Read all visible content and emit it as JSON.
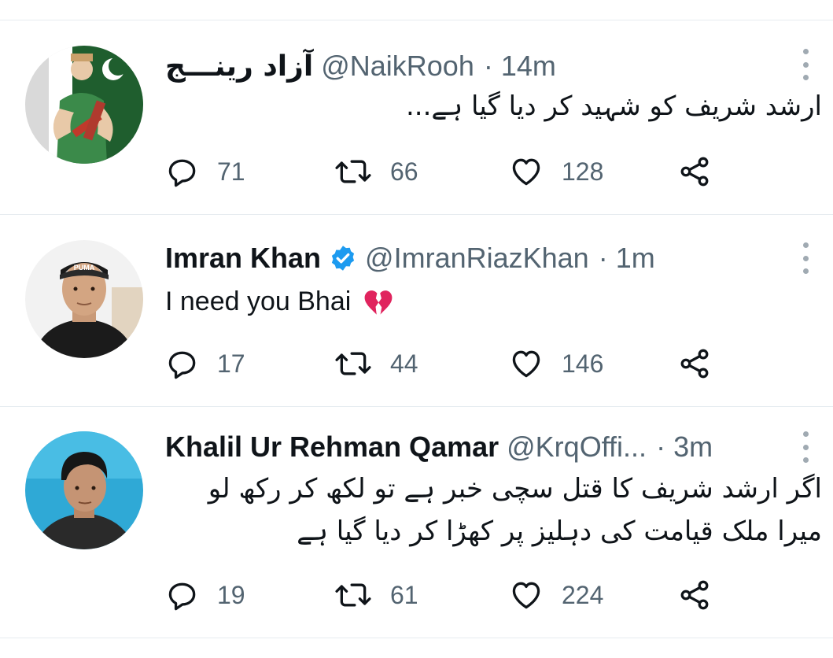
{
  "tweets": [
    {
      "display_name": "آزاد رینـــج",
      "handle": "@NaikRooh",
      "separator": "·",
      "time": "14m",
      "text": "ارشد شریف کو شہید کر دیا گیا ہے...",
      "replies": "71",
      "retweets": "66",
      "likes": "128"
    },
    {
      "display_name": "Imran Khan",
      "handle": "@ImranRiazKhan",
      "separator": "·",
      "time": "1m",
      "text": "I need you Bhai",
      "emoji": "broken-heart",
      "verified": true,
      "replies": "17",
      "retweets": "44",
      "likes": "146"
    },
    {
      "display_name": "Khalil Ur Rehman Qamar",
      "handle": "@KrqOffi...",
      "separator": "·",
      "time": "3m",
      "text_line1": "اگر ارشد شریف کا قتل سچی خبر ہے تو لکھ کر رکھ لو",
      "text_line2": "میرا ملک قیامت کی دہلیز پر کھڑا کر دیا گیا ہے",
      "replies": "19",
      "retweets": "61",
      "likes": "224"
    }
  ],
  "colors": {
    "text": "#0f1419",
    "secondary": "#536471",
    "verified": "#1d9bf0",
    "divider": "#e6ecf0",
    "broken_heart": "#e0245e"
  },
  "icons": [
    "reply-icon",
    "retweet-icon",
    "like-icon",
    "share-icon",
    "more-icon",
    "verified-badge-icon"
  ]
}
